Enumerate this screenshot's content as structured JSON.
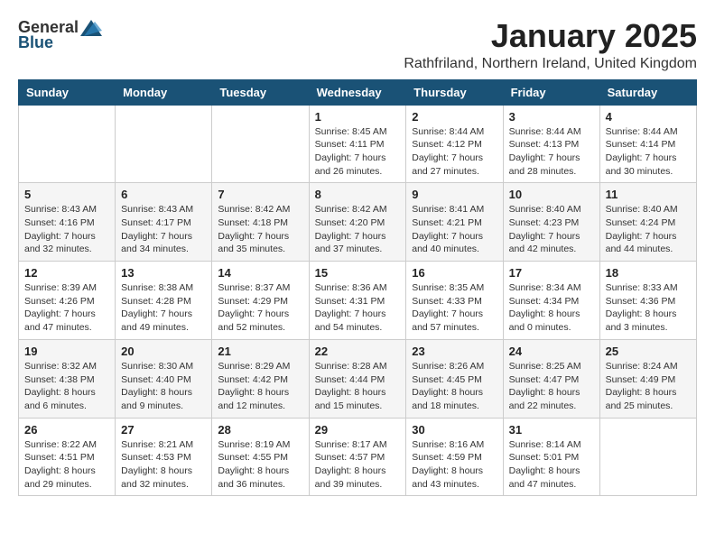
{
  "logo": {
    "general": "General",
    "blue": "Blue"
  },
  "title": {
    "month": "January 2025",
    "location": "Rathfriland, Northern Ireland, United Kingdom"
  },
  "days_of_week": [
    "Sunday",
    "Monday",
    "Tuesday",
    "Wednesday",
    "Thursday",
    "Friday",
    "Saturday"
  ],
  "weeks": [
    [
      {
        "num": "",
        "detail": ""
      },
      {
        "num": "",
        "detail": ""
      },
      {
        "num": "",
        "detail": ""
      },
      {
        "num": "1",
        "detail": "Sunrise: 8:45 AM\nSunset: 4:11 PM\nDaylight: 7 hours and 26 minutes."
      },
      {
        "num": "2",
        "detail": "Sunrise: 8:44 AM\nSunset: 4:12 PM\nDaylight: 7 hours and 27 minutes."
      },
      {
        "num": "3",
        "detail": "Sunrise: 8:44 AM\nSunset: 4:13 PM\nDaylight: 7 hours and 28 minutes."
      },
      {
        "num": "4",
        "detail": "Sunrise: 8:44 AM\nSunset: 4:14 PM\nDaylight: 7 hours and 30 minutes."
      }
    ],
    [
      {
        "num": "5",
        "detail": "Sunrise: 8:43 AM\nSunset: 4:16 PM\nDaylight: 7 hours and 32 minutes."
      },
      {
        "num": "6",
        "detail": "Sunrise: 8:43 AM\nSunset: 4:17 PM\nDaylight: 7 hours and 34 minutes."
      },
      {
        "num": "7",
        "detail": "Sunrise: 8:42 AM\nSunset: 4:18 PM\nDaylight: 7 hours and 35 minutes."
      },
      {
        "num": "8",
        "detail": "Sunrise: 8:42 AM\nSunset: 4:20 PM\nDaylight: 7 hours and 37 minutes."
      },
      {
        "num": "9",
        "detail": "Sunrise: 8:41 AM\nSunset: 4:21 PM\nDaylight: 7 hours and 40 minutes."
      },
      {
        "num": "10",
        "detail": "Sunrise: 8:40 AM\nSunset: 4:23 PM\nDaylight: 7 hours and 42 minutes."
      },
      {
        "num": "11",
        "detail": "Sunrise: 8:40 AM\nSunset: 4:24 PM\nDaylight: 7 hours and 44 minutes."
      }
    ],
    [
      {
        "num": "12",
        "detail": "Sunrise: 8:39 AM\nSunset: 4:26 PM\nDaylight: 7 hours and 47 minutes."
      },
      {
        "num": "13",
        "detail": "Sunrise: 8:38 AM\nSunset: 4:28 PM\nDaylight: 7 hours and 49 minutes."
      },
      {
        "num": "14",
        "detail": "Sunrise: 8:37 AM\nSunset: 4:29 PM\nDaylight: 7 hours and 52 minutes."
      },
      {
        "num": "15",
        "detail": "Sunrise: 8:36 AM\nSunset: 4:31 PM\nDaylight: 7 hours and 54 minutes."
      },
      {
        "num": "16",
        "detail": "Sunrise: 8:35 AM\nSunset: 4:33 PM\nDaylight: 7 hours and 57 minutes."
      },
      {
        "num": "17",
        "detail": "Sunrise: 8:34 AM\nSunset: 4:34 PM\nDaylight: 8 hours and 0 minutes."
      },
      {
        "num": "18",
        "detail": "Sunrise: 8:33 AM\nSunset: 4:36 PM\nDaylight: 8 hours and 3 minutes."
      }
    ],
    [
      {
        "num": "19",
        "detail": "Sunrise: 8:32 AM\nSunset: 4:38 PM\nDaylight: 8 hours and 6 minutes."
      },
      {
        "num": "20",
        "detail": "Sunrise: 8:30 AM\nSunset: 4:40 PM\nDaylight: 8 hours and 9 minutes."
      },
      {
        "num": "21",
        "detail": "Sunrise: 8:29 AM\nSunset: 4:42 PM\nDaylight: 8 hours and 12 minutes."
      },
      {
        "num": "22",
        "detail": "Sunrise: 8:28 AM\nSunset: 4:44 PM\nDaylight: 8 hours and 15 minutes."
      },
      {
        "num": "23",
        "detail": "Sunrise: 8:26 AM\nSunset: 4:45 PM\nDaylight: 8 hours and 18 minutes."
      },
      {
        "num": "24",
        "detail": "Sunrise: 8:25 AM\nSunset: 4:47 PM\nDaylight: 8 hours and 22 minutes."
      },
      {
        "num": "25",
        "detail": "Sunrise: 8:24 AM\nSunset: 4:49 PM\nDaylight: 8 hours and 25 minutes."
      }
    ],
    [
      {
        "num": "26",
        "detail": "Sunrise: 8:22 AM\nSunset: 4:51 PM\nDaylight: 8 hours and 29 minutes."
      },
      {
        "num": "27",
        "detail": "Sunrise: 8:21 AM\nSunset: 4:53 PM\nDaylight: 8 hours and 32 minutes."
      },
      {
        "num": "28",
        "detail": "Sunrise: 8:19 AM\nSunset: 4:55 PM\nDaylight: 8 hours and 36 minutes."
      },
      {
        "num": "29",
        "detail": "Sunrise: 8:17 AM\nSunset: 4:57 PM\nDaylight: 8 hours and 39 minutes."
      },
      {
        "num": "30",
        "detail": "Sunrise: 8:16 AM\nSunset: 4:59 PM\nDaylight: 8 hours and 43 minutes."
      },
      {
        "num": "31",
        "detail": "Sunrise: 8:14 AM\nSunset: 5:01 PM\nDaylight: 8 hours and 47 minutes."
      },
      {
        "num": "",
        "detail": ""
      }
    ]
  ]
}
